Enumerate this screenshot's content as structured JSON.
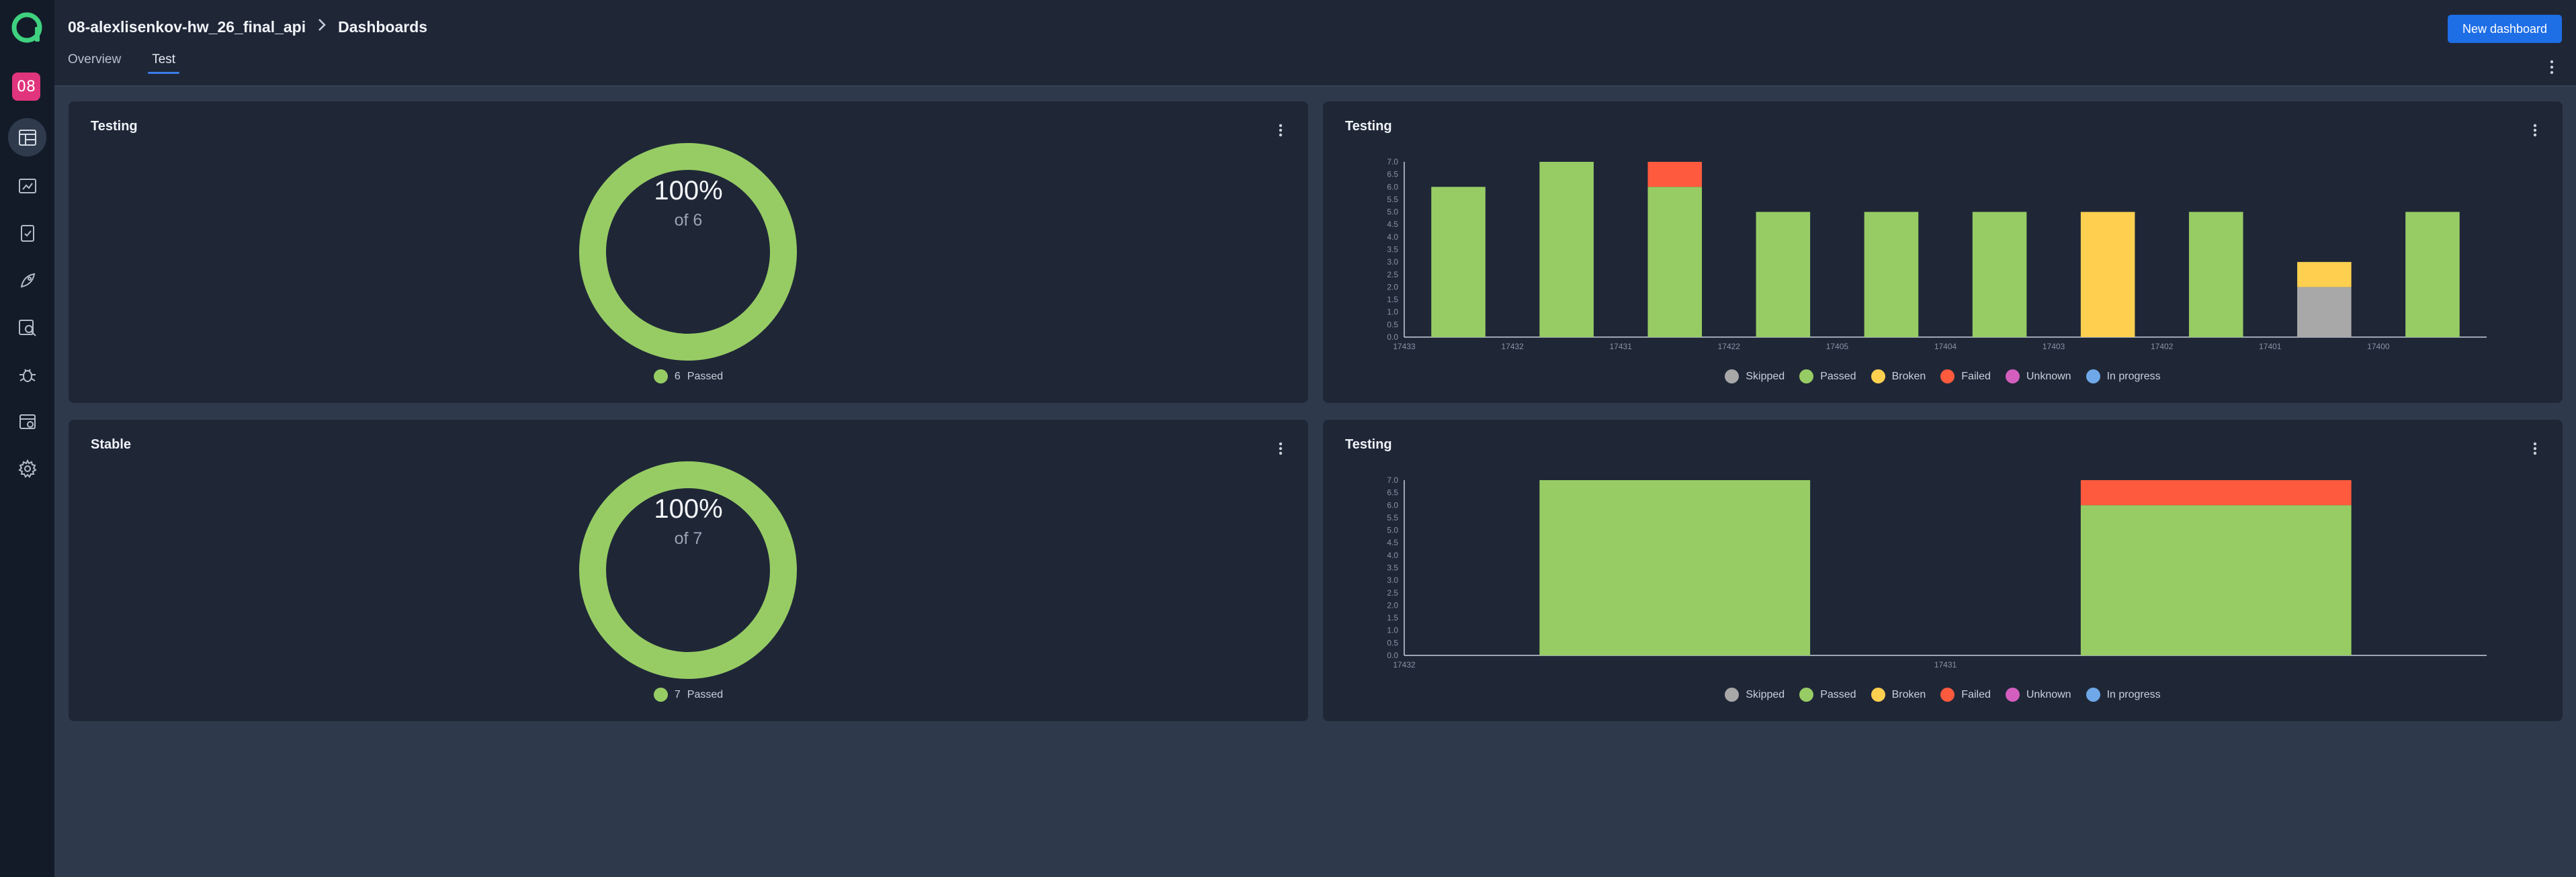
{
  "project": {
    "badge": "08"
  },
  "header": {
    "project_name": "08-alexlisenkov-hw_26_final_api",
    "section": "Dashboards",
    "new_dashboard_label": "New dashboard",
    "tabs": [
      {
        "label": "Overview",
        "active": false
      },
      {
        "label": "Test",
        "active": true
      }
    ]
  },
  "colors": {
    "Skipped": "#a8a8a8",
    "Passed": "#97cc64",
    "Broken": "#ffd050",
    "Failed": "#fd5a3e",
    "Unknown": "#d35ebe",
    "In progress": "#6fa8e8"
  },
  "legend_labels": [
    "Skipped",
    "Passed",
    "Broken",
    "Failed",
    "Unknown",
    "In progress"
  ],
  "widgets": [
    {
      "title": "Testing",
      "type": "pie",
      "percent": "100%",
      "of_text": "of 6",
      "legend": {
        "count": "6",
        "label": "Passed"
      }
    },
    {
      "title": "Testing",
      "type": "bar"
    },
    {
      "title": "Stable",
      "type": "pie",
      "percent": "100%",
      "of_text": "of 7",
      "legend": {
        "count": "7",
        "label": "Passed"
      }
    },
    {
      "title": "Testing",
      "type": "bar"
    }
  ],
  "chart_data": [
    {
      "type": "pie",
      "slices": [
        {
          "name": "Passed",
          "value": 6
        }
      ]
    },
    {
      "type": "bar",
      "stacked": true,
      "x_tick_labels": [
        "17433",
        "17432",
        "17431",
        "17422",
        "17405",
        "17404",
        "17403",
        "17402",
        "17401",
        "17400"
      ],
      "ylim": [
        0,
        7
      ],
      "y_ticks": [
        "0.0",
        "0.5",
        "1.0",
        "1.5",
        "2.0",
        "2.5",
        "3.0",
        "3.5",
        "4.0",
        "4.5",
        "5.0",
        "5.5",
        "6.0",
        "6.5",
        "7.0"
      ],
      "series": [
        {
          "name": "Skipped",
          "values": [
            0,
            0,
            0,
            0,
            0,
            0,
            0,
            0,
            2,
            0
          ]
        },
        {
          "name": "Passed",
          "values": [
            6,
            7,
            6,
            5,
            5,
            5,
            0,
            5,
            0,
            5
          ]
        },
        {
          "name": "Broken",
          "values": [
            0,
            0,
            0,
            0,
            0,
            0,
            5,
            0,
            1,
            0
          ]
        },
        {
          "name": "Failed",
          "values": [
            0,
            0,
            1,
            0,
            0,
            0,
            0,
            0,
            0,
            0
          ]
        }
      ],
      "legend_position": "bottom"
    },
    {
      "type": "pie",
      "slices": [
        {
          "name": "Passed",
          "value": 7
        }
      ]
    },
    {
      "type": "bar",
      "stacked": true,
      "x_tick_labels": [
        "17432",
        "17431"
      ],
      "ylim": [
        0,
        7
      ],
      "y_ticks": [
        "0.0",
        "0.5",
        "1.0",
        "1.5",
        "2.0",
        "2.5",
        "3.0",
        "3.5",
        "4.0",
        "4.5",
        "5.0",
        "5.5",
        "6.0",
        "6.5",
        "7.0"
      ],
      "series": [
        {
          "name": "Passed",
          "values": [
            7,
            6
          ]
        },
        {
          "name": "Failed",
          "values": [
            0,
            1
          ]
        }
      ],
      "legend_position": "bottom"
    }
  ]
}
